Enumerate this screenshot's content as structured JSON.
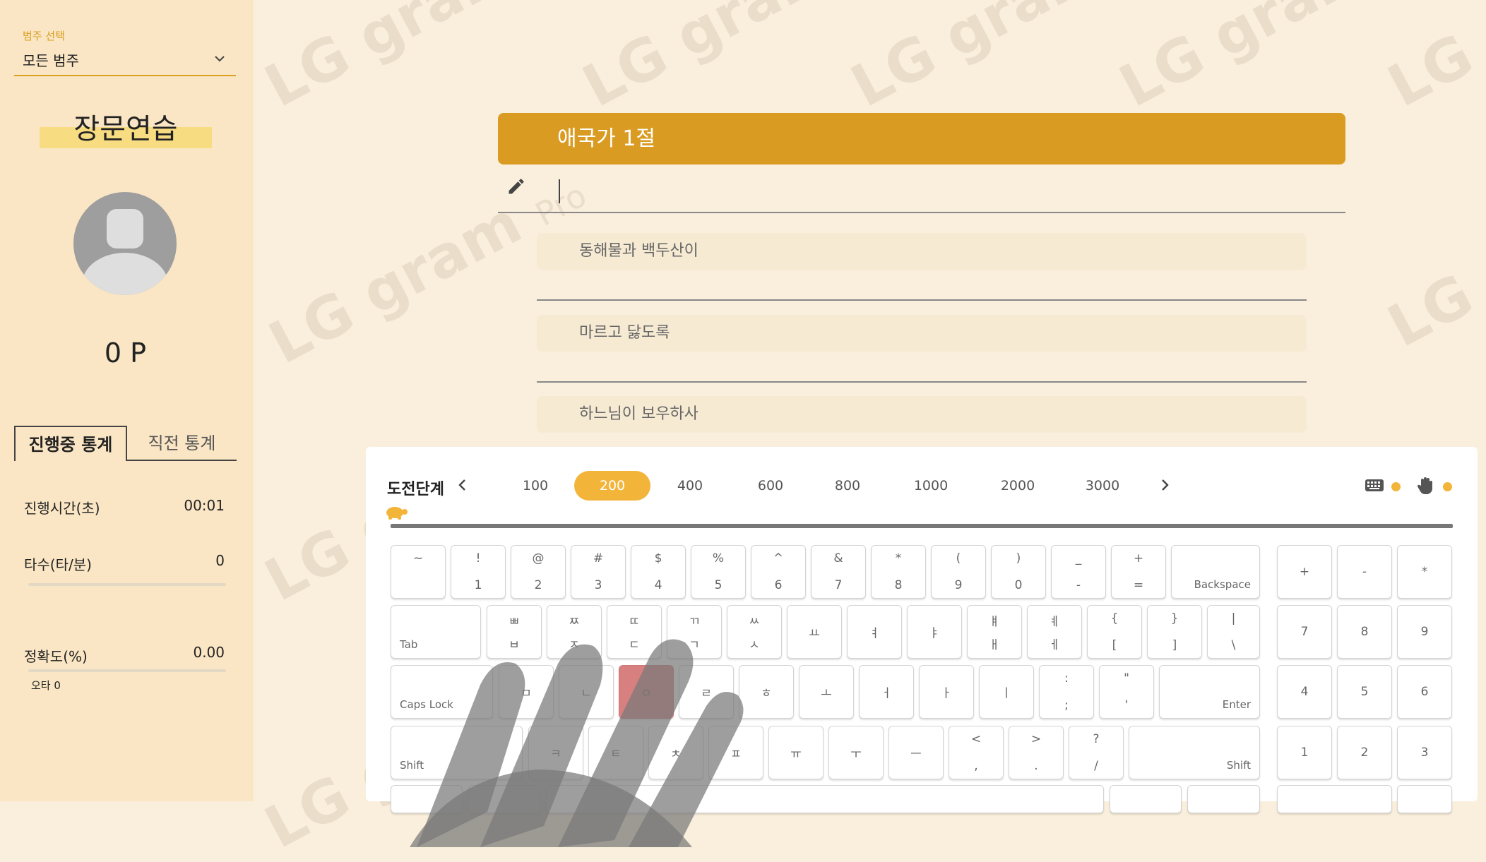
{
  "sidebar": {
    "category_label": "범주 선택",
    "category_value": "모든 범주",
    "title": "장문연습",
    "points": "0 P",
    "tabs": [
      "진행중 통계",
      "직전 통계"
    ],
    "stats": [
      {
        "label": "진행시간(초)",
        "value": "00:01"
      },
      {
        "label": "타수(타/분)",
        "value": "0"
      },
      {
        "label": "정확도(%)",
        "value": "0.00"
      }
    ],
    "typo": "오타 0"
  },
  "watermark": {
    "text": "LG gram",
    "pro": "Pro"
  },
  "practice": {
    "title": "애국가 1절",
    "lines": [
      "동해물과 백두산이",
      "마르고 닳도록",
      "하느님이 보우하사"
    ]
  },
  "keyboard": {
    "level_label": "도전단계",
    "levels": [
      "100",
      "200",
      "400",
      "600",
      "800",
      "1000",
      "2000",
      "3000"
    ],
    "active_level": "200",
    "row1": [
      [
        "~",
        ""
      ],
      [
        "!",
        "1"
      ],
      [
        "@",
        "2"
      ],
      [
        "#",
        "3"
      ],
      [
        "$",
        "4"
      ],
      [
        "%",
        "5"
      ],
      [
        "^",
        "6"
      ],
      [
        "&",
        "7"
      ],
      [
        "*",
        "8"
      ],
      [
        "(",
        "9"
      ],
      [
        ")",
        "0"
      ],
      [
        "_",
        "-"
      ],
      [
        "+",
        "="
      ]
    ],
    "backspace": "Backspace",
    "tab": "Tab",
    "row2": [
      [
        "ㅃ",
        "ㅂ"
      ],
      [
        "ㅉ",
        "ㅈ"
      ],
      [
        "ㄸ",
        "ㄷ"
      ],
      [
        "ㄲ",
        "ㄱ"
      ],
      [
        "ㅆ",
        "ㅅ"
      ],
      [
        "",
        "ㅛ"
      ],
      [
        "",
        "ㅕ"
      ],
      [
        "",
        "ㅑ"
      ],
      [
        "ㅒ",
        "ㅐ"
      ],
      [
        "ㅖ",
        "ㅔ"
      ],
      [
        "{",
        "["
      ],
      [
        "}",
        "]"
      ],
      [
        "|",
        "\\"
      ]
    ],
    "caps": "Caps Lock",
    "row3": [
      "ㅁ",
      "ㄴ",
      "ㅇ",
      "ㄹ",
      "ㅎ",
      "ㅗ",
      "ㅓ",
      "ㅏ",
      "ㅣ"
    ],
    "row3_punct": [
      [
        ":",
        ";"
      ],
      [
        "\"",
        "'"
      ]
    ],
    "enter": "Enter",
    "shift": "Shift",
    "row4": [
      "ㅋ",
      "ㅌ",
      "ㅊ",
      "ㅍ",
      "ㅠ",
      "ㅜ",
      "ㅡ"
    ],
    "row4_punct": [
      [
        "<",
        ","
      ],
      [
        ">",
        "."
      ],
      [
        "?",
        "/"
      ]
    ],
    "numpad": [
      "+",
      "-",
      "*",
      "7",
      "8",
      "9",
      "4",
      "5",
      "6",
      "1",
      "2",
      "3"
    ],
    "highlight_key": "ㅇ",
    "accent": "#f3b43a"
  }
}
